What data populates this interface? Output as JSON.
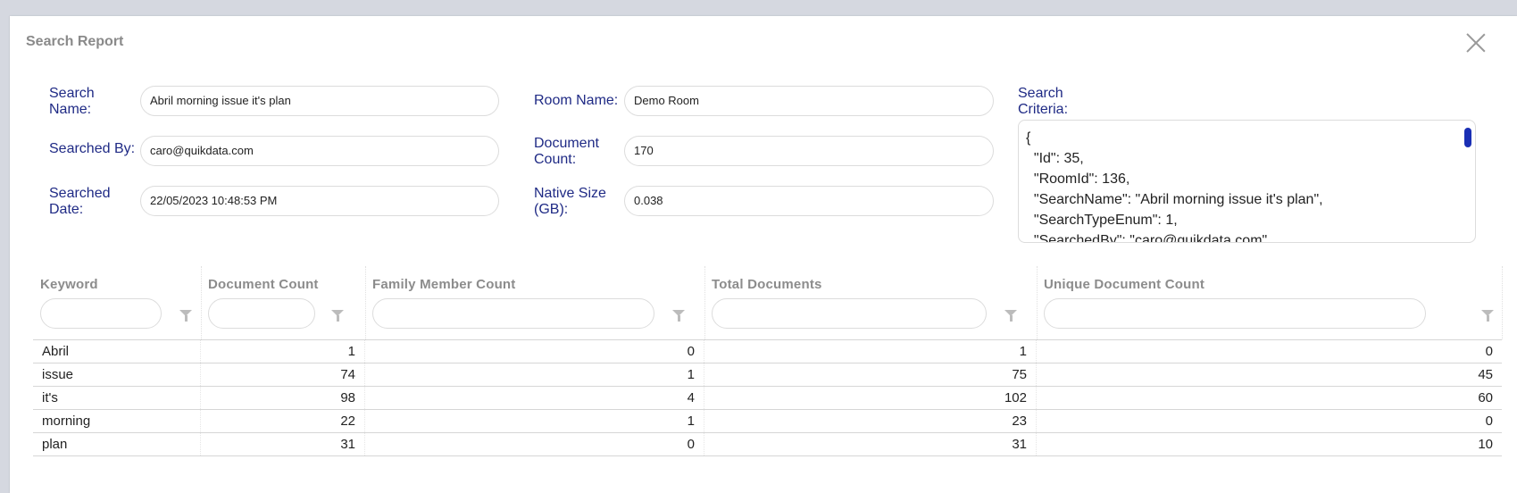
{
  "dialog": {
    "title": "Search Report"
  },
  "form": {
    "search_name_label": "Search Name:",
    "search_name_value": "Abril morning issue it's plan",
    "searched_by_label": "Searched By:",
    "searched_by_value": "caro@quikdata.com",
    "searched_date_label": "Searched Date:",
    "searched_date_value": "22/05/2023 10:48:53 PM",
    "room_name_label": "Room Name:",
    "room_name_value": "Demo Room",
    "document_count_label": "Document Count:",
    "document_count_value": "170",
    "native_size_label": "Native Size (GB):",
    "native_size_value": "0.038",
    "search_criteria_label": "Search Criteria:",
    "search_criteria_value": "{\n  \"Id\": 35,\n  \"RoomId\": 136,\n  \"SearchName\": \"Abril morning issue it's plan\",\n  \"SearchTypeEnum\": 1,\n  \"SearchedBy\": \"caro@quikdata.com\","
  },
  "grid": {
    "columns": [
      "Keyword",
      "Document Count",
      "Family Member Count",
      "Total Documents",
      "Unique Document Count"
    ],
    "rows": [
      [
        "Abril",
        "1",
        "0",
        "1",
        "0"
      ],
      [
        "issue",
        "74",
        "1",
        "75",
        "45"
      ],
      [
        "it's",
        "98",
        "4",
        "102",
        "60"
      ],
      [
        "morning",
        "22",
        "1",
        "23",
        "0"
      ],
      [
        "plan",
        "31",
        "0",
        "31",
        "10"
      ]
    ]
  }
}
